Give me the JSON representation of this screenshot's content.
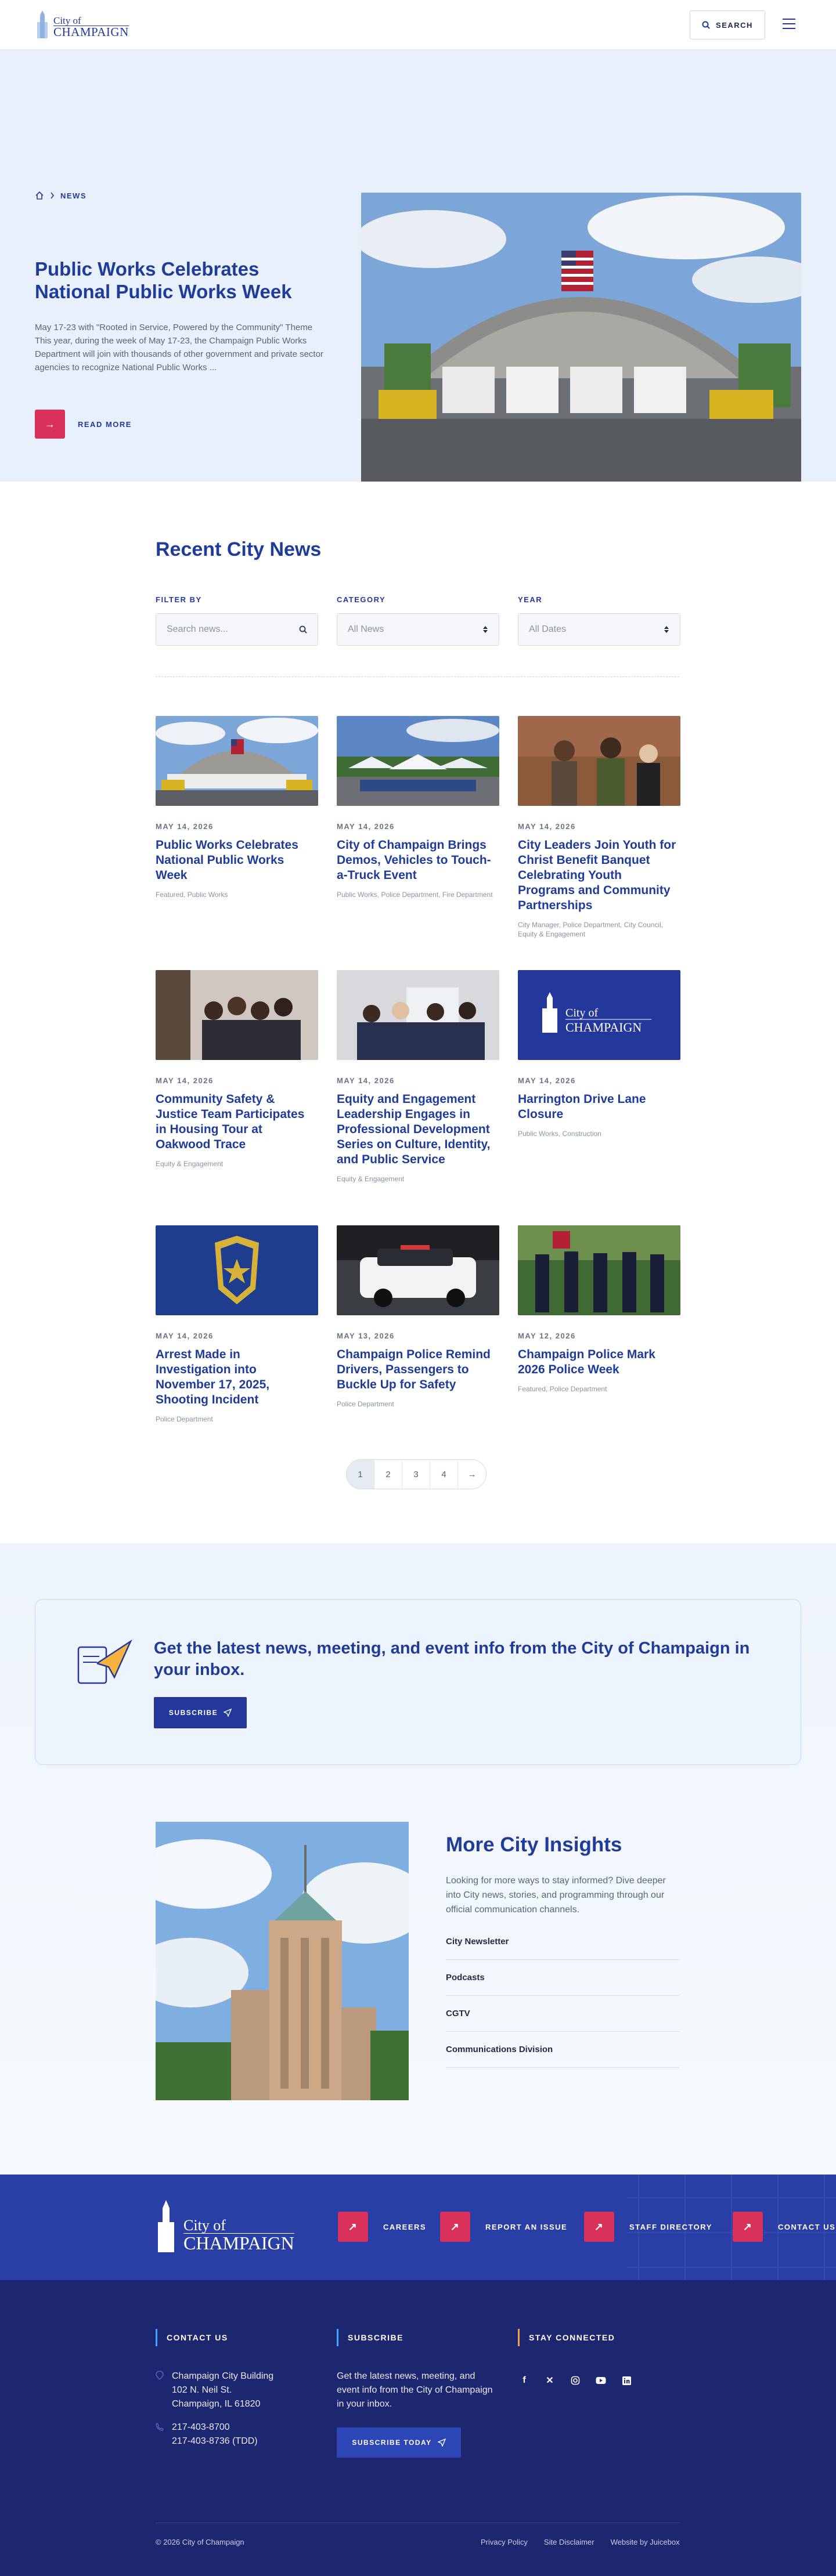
{
  "header": {
    "logo_city": "City of",
    "logo_name": "CHAMPAIGN",
    "search_label": "SEARCH"
  },
  "hero": {
    "breadcrumb_current": "NEWS",
    "title": "Public Works Celebrates National Public Works Week",
    "excerpt": "May 17-23 with \"Rooted in Service, Powered by the Community\" Theme This year, during the week of May 17-23, the Champaign Public Works Department will join with thousands of other government and private sector agencies to recognize National Public Works ...",
    "read_more": "READ MORE"
  },
  "news": {
    "heading": "Recent City News",
    "filters": {
      "filter_by_label": "FILTER BY",
      "search_placeholder": "Search news...",
      "category_label": "CATEGORY",
      "category_value": "All News",
      "year_label": "YEAR",
      "year_value": "All Dates"
    },
    "cards": [
      {
        "date": "MAY 14, 2026",
        "title": "Public Works Celebrates National Public Works Week",
        "tags": "Featured, Public Works"
      },
      {
        "date": "MAY 14, 2026",
        "title": "City of Champaign Brings Demos, Vehicles to Touch-a-Truck Event",
        "tags": "Public Works, Police Department, Fire Department"
      },
      {
        "date": "MAY 14, 2026",
        "title": "City Leaders Join Youth for Christ Benefit Banquet Celebrating Youth Programs and Community Partnerships",
        "tags": "City Manager, Police Department, City Council, Equity & Engagement"
      },
      {
        "date": "MAY 14, 2026",
        "title": "Community Safety & Justice Team Participates in Housing Tour at Oakwood Trace",
        "tags": "Equity & Engagement"
      },
      {
        "date": "MAY 14, 2026",
        "title": "Equity and Engagement Leadership Engages in Professional Development Series on Culture, Identity, and Public Service",
        "tags": "Equity & Engagement"
      },
      {
        "date": "MAY 14, 2026",
        "title": "Harrington Drive Lane Closure",
        "tags": "Public Works, Construction"
      },
      {
        "date": "MAY 14, 2026",
        "title": "Arrest Made in Investigation into November 17, 2025, Shooting Incident",
        "tags": "Police Department"
      },
      {
        "date": "MAY 13, 2026",
        "title": "Champaign Police Remind Drivers, Passengers to Buckle Up for Safety",
        "tags": "Police Department"
      },
      {
        "date": "MAY 12, 2026",
        "title": "Champaign Police Mark 2026 Police Week",
        "tags": "Featured, Police Department"
      }
    ],
    "pagination": [
      "1",
      "2",
      "3",
      "4",
      "→"
    ]
  },
  "subscribe": {
    "heading": "Get the latest news, meeting, and event info from the City of Champaign in your inbox.",
    "button": "SUBSCRIBE"
  },
  "insights": {
    "heading": "More City Insights",
    "description": "Looking for more ways to stay informed? Dive deeper into City news, stories, and programming through our official communication channels.",
    "links": [
      "City Newsletter",
      "Podcasts",
      "CGTV",
      "Communications Division"
    ]
  },
  "footer": {
    "logo_city": "City of",
    "logo_name": "CHAMPAIGN",
    "quick_links": [
      "CAREERS",
      "REPORT AN ISSUE",
      "STAFF DIRECTORY",
      "CONTACT US"
    ],
    "contact_heading": "CONTACT US",
    "address_lines": [
      "Champaign City Building",
      "102 N. Neil St.",
      "Champaign, IL 61820"
    ],
    "phone_lines": [
      "217-403-8700",
      "217-403-8736 (TDD)"
    ],
    "subscribe_heading": "SUBSCRIBE",
    "subscribe_text": "Get the latest news, meeting, and event info from the City of Champaign in your inbox.",
    "subscribe_button": "SUBSCRIBE TODAY",
    "stay_heading": "STAY CONNECTED",
    "copyright": "© 2026 City of Champaign",
    "legal_links": [
      "Privacy Policy",
      "Site Disclaimer",
      "Website by Juicebox"
    ]
  },
  "colors": {
    "brand_blue": "#23389a",
    "accent_red": "#d8325a",
    "footer_navy": "#1d276f"
  }
}
